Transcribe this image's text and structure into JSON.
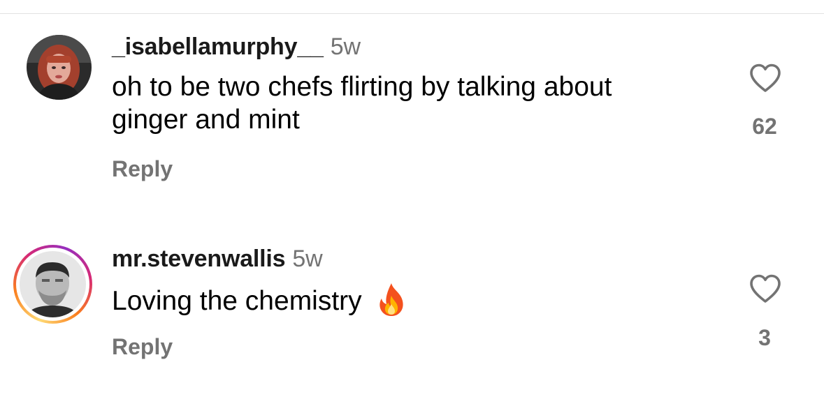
{
  "comments": [
    {
      "username": "_isabellamurphy__",
      "time": "5w",
      "text_lines": [
        "oh to be two chefs flirting by talking about",
        "ginger and mint"
      ],
      "reply_label": "Reply",
      "likes": "62",
      "avatar": "woman-red-hair-photo",
      "has_story_ring": false
    },
    {
      "username": "mr.stevenwallis",
      "time": "5w",
      "text": "Loving the chemistry",
      "emoji": "fire-icon",
      "reply_label": "Reply",
      "likes": "3",
      "avatar": "man-grayscale-photo",
      "has_story_ring": true
    }
  ],
  "colors": {
    "secondary_text": "#737373",
    "divider": "#e2e2e2",
    "story_ring": [
      "#feda75",
      "#fa7e1e",
      "#d62976",
      "#962fbf"
    ]
  }
}
